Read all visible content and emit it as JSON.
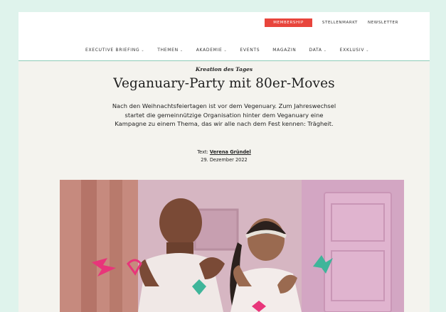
{
  "topbar": {
    "membership": "MEMBERSHIP",
    "links": [
      "STELLENMARKT",
      "NEWSLETTER"
    ]
  },
  "nav": {
    "items": [
      {
        "label": "EXECUTIVE BRIEFING",
        "dropdown": true
      },
      {
        "label": "THEMEN",
        "dropdown": true
      },
      {
        "label": "AKADEMIE",
        "dropdown": true
      },
      {
        "label": "EVENTS",
        "dropdown": false
      },
      {
        "label": "MAGAZIN",
        "dropdown": false
      },
      {
        "label": "DATA",
        "dropdown": true
      },
      {
        "label": "EXKLUSIV",
        "dropdown": true
      }
    ]
  },
  "article": {
    "kicker": "Kreation des Tages",
    "title": "Veganuary-Party mit 80er-Moves",
    "lead_lines": [
      "Nach den Weihnachtsfeiertagen ist vor dem Vegenuary. Zum Jahreswechsel",
      "startet die gemeinnützige Organisation hinter dem Veganuary eine",
      "Kampagne zu einem Thema, das wir alle nach dem Fest kennen: Trägheit."
    ],
    "byline_prefix": "Text:",
    "author": "Verena Gründel",
    "date": "29. Dezember 2022"
  },
  "colors": {
    "background": "#dff3ec",
    "page": "#f4f3ee",
    "accent_red": "#e8453c",
    "nav_border": "#8dcbb8"
  }
}
